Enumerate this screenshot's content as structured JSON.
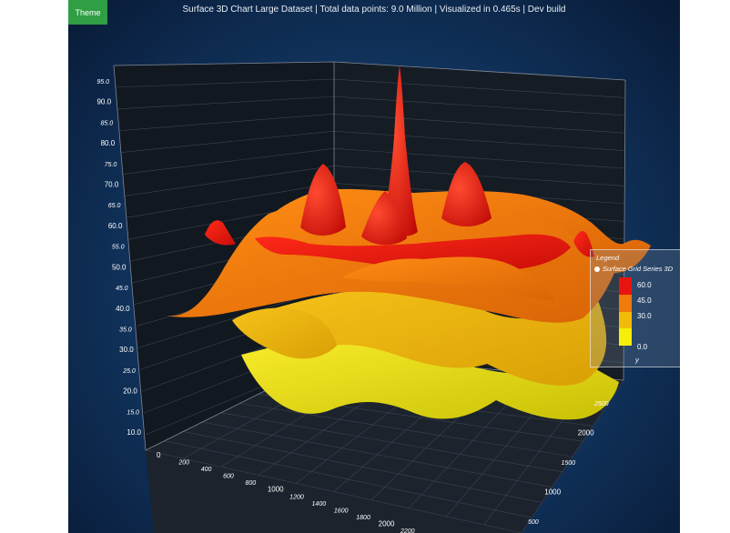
{
  "theme_button": {
    "label": "Theme"
  },
  "title": "Surface 3D Chart Large Dataset | Total data points: 9.0 Million | Visualized in 0.465s | Dev build",
  "chart_data": {
    "type": "surface-3d",
    "title": "Surface 3D Chart Large Dataset | Total data points: 9.0 Million | Visualized in 0.465s | Dev build",
    "y_ticks": [
      "10.0",
      "15.0",
      "20.0",
      "25.0",
      "30.0",
      "35.0",
      "40.0",
      "45.0",
      "50.0",
      "55.0",
      "60.0",
      "65.0",
      "70.0",
      "75.0",
      "80.0",
      "85.0",
      "90.0",
      "95.0"
    ],
    "x_ticks": [
      "0",
      "200",
      "400",
      "600",
      "800",
      "1000",
      "1200",
      "1400",
      "1600",
      "1800",
      "2000",
      "2200"
    ],
    "z_ticks": [
      "500",
      "1000",
      "1500",
      "2000",
      "2500"
    ],
    "ylim": [
      10,
      95
    ],
    "xlim": [
      0,
      2200
    ],
    "zlim": [
      500,
      2500
    ],
    "series": [
      {
        "name": "Surface Grid Series 3D"
      }
    ],
    "color_scale": {
      "label": "y",
      "steps": [
        {
          "value": "60.0",
          "color": "#e8140f"
        },
        {
          "value": "45.0",
          "color": "#f07a0a"
        },
        {
          "value": "30.0",
          "color": "#f2bb0a"
        },
        {
          "value": "0.0",
          "color": "#f6ef08"
        }
      ]
    },
    "grid": true,
    "legend_position": "right"
  },
  "legend": {
    "title": "Legend",
    "series_name": "Surface Grid Series 3D",
    "unit": "y"
  }
}
